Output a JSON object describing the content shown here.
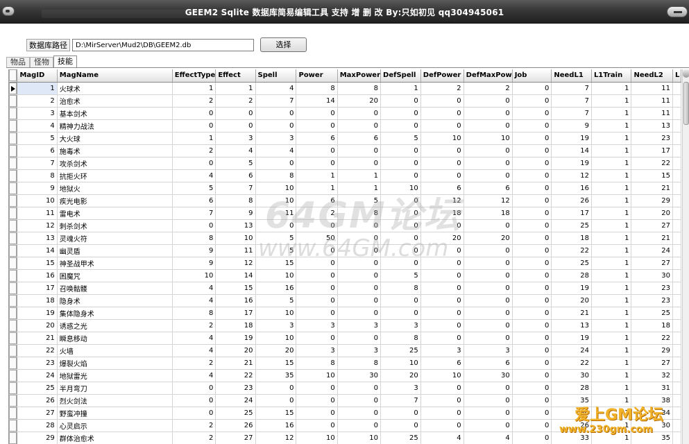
{
  "window": {
    "title": "GEEM2 Sqlite 数据库简易编辑工具 支持 增 删 改 By:只如初见 qq304945061"
  },
  "path": {
    "label": "数据库路径",
    "value": "D:\\MirServer\\Mud2\\DB\\GEEM2.db",
    "select_button": "选择"
  },
  "tabs": [
    {
      "label": "物品",
      "active": false
    },
    {
      "label": "怪物",
      "active": false
    },
    {
      "label": "技能",
      "active": true
    }
  ],
  "grid": {
    "columns": [
      "MagID",
      "MagName",
      "EffectType",
      "Effect",
      "Spell",
      "Power",
      "MaxPower",
      "DefSpell",
      "DefPower",
      "DefMaxPow",
      "Job",
      "NeedL1",
      "L1Train",
      "NeedL2",
      "L"
    ],
    "rows": [
      [
        1,
        "火球术",
        1,
        1,
        4,
        8,
        8,
        1,
        2,
        2,
        0,
        7,
        1,
        11
      ],
      [
        2,
        "治愈术",
        2,
        2,
        7,
        14,
        20,
        0,
        0,
        0,
        0,
        7,
        1,
        11
      ],
      [
        3,
        "基本剑术",
        0,
        0,
        0,
        0,
        0,
        0,
        0,
        0,
        0,
        7,
        1,
        11
      ],
      [
        4,
        "精神力战法",
        0,
        0,
        0,
        0,
        0,
        0,
        0,
        0,
        0,
        9,
        1,
        13
      ],
      [
        5,
        "大火球",
        1,
        3,
        3,
        6,
        6,
        5,
        10,
        10,
        0,
        19,
        1,
        23
      ],
      [
        6,
        "施毒术",
        2,
        4,
        4,
        0,
        0,
        0,
        0,
        0,
        0,
        14,
        1,
        17
      ],
      [
        7,
        "攻杀剑术",
        0,
        5,
        0,
        0,
        0,
        0,
        0,
        0,
        0,
        19,
        1,
        22
      ],
      [
        8,
        "抗拒火环",
        4,
        6,
        8,
        1,
        1,
        0,
        0,
        0,
        0,
        12,
        1,
        15
      ],
      [
        9,
        "地狱火",
        5,
        7,
        10,
        1,
        1,
        10,
        6,
        6,
        0,
        16,
        1,
        21
      ],
      [
        10,
        "疾光电影",
        6,
        8,
        10,
        6,
        5,
        0,
        12,
        12,
        0,
        26,
        1,
        29
      ],
      [
        11,
        "雷电术",
        7,
        9,
        11,
        2,
        8,
        0,
        18,
        18,
        0,
        17,
        1,
        20
      ],
      [
        12,
        "刺杀剑术",
        0,
        13,
        0,
        0,
        0,
        0,
        0,
        0,
        0,
        25,
        1,
        27
      ],
      [
        13,
        "灵魂火符",
        8,
        10,
        5,
        50,
        0,
        0,
        20,
        20,
        0,
        18,
        1,
        21
      ],
      [
        14,
        "幽灵盾",
        9,
        11,
        5,
        0,
        0,
        0,
        0,
        0,
        0,
        22,
        1,
        24
      ],
      [
        15,
        "神圣战甲术",
        9,
        12,
        15,
        0,
        0,
        0,
        0,
        0,
        0,
        25,
        1,
        27
      ],
      [
        16,
        "困魔咒",
        10,
        14,
        10,
        0,
        0,
        5,
        0,
        0,
        0,
        28,
        1,
        30
      ],
      [
        17,
        "召唤骷髅",
        4,
        15,
        16,
        0,
        0,
        8,
        0,
        0,
        0,
        19,
        1,
        23
      ],
      [
        18,
        "隐身术",
        4,
        16,
        5,
        0,
        0,
        0,
        0,
        0,
        0,
        20,
        1,
        23
      ],
      [
        19,
        "集体隐身术",
        8,
        17,
        10,
        0,
        0,
        0,
        0,
        0,
        0,
        21,
        1,
        25
      ],
      [
        20,
        "诱惑之光",
        2,
        18,
        3,
        3,
        3,
        3,
        0,
        0,
        0,
        13,
        1,
        18
      ],
      [
        21,
        "瞬息移动",
        4,
        19,
        10,
        0,
        0,
        8,
        0,
        0,
        0,
        19,
        1,
        22
      ],
      [
        22,
        "火墙",
        4,
        20,
        20,
        3,
        3,
        25,
        3,
        3,
        0,
        24,
        1,
        29
      ],
      [
        23,
        "爆裂火焰",
        2,
        21,
        15,
        8,
        8,
        10,
        6,
        6,
        0,
        22,
        1,
        27
      ],
      [
        24,
        "地狱雷光",
        4,
        22,
        35,
        10,
        30,
        20,
        10,
        30,
        0,
        30,
        1,
        32
      ],
      [
        25,
        "半月弯刀",
        0,
        23,
        0,
        0,
        0,
        3,
        0,
        0,
        0,
        28,
        1,
        31
      ],
      [
        26,
        "烈火剑法",
        0,
        24,
        0,
        0,
        0,
        7,
        0,
        0,
        0,
        35,
        1,
        38
      ],
      [
        27,
        "野蛮冲撞",
        0,
        25,
        15,
        0,
        0,
        0,
        0,
        0,
        0,
        30,
        1,
        34
      ],
      [
        28,
        "心灵启示",
        2,
        26,
        16,
        0,
        0,
        0,
        0,
        0,
        0,
        26,
        1,
        30
      ],
      [
        29,
        "群体治愈术",
        2,
        27,
        12,
        10,
        10,
        25,
        4,
        4,
        0,
        33,
        1,
        35
      ]
    ]
  },
  "watermarks": {
    "main": "64GM论坛",
    "url": "www.64GM.com",
    "corner_title": "爱上GM论坛",
    "corner_url": "www.230gm.com"
  }
}
